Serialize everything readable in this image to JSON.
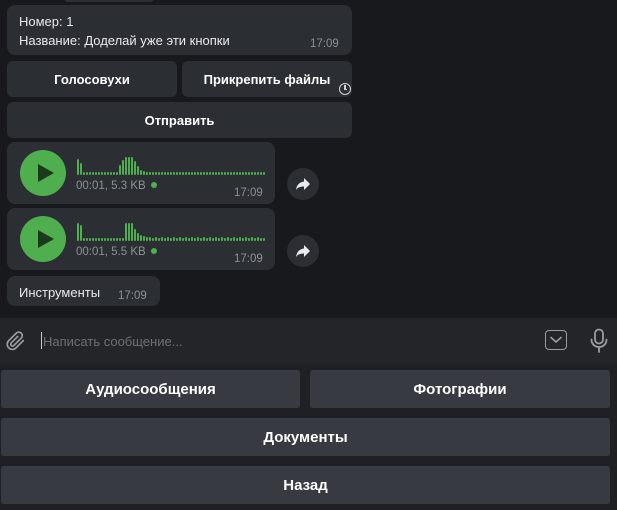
{
  "messages": {
    "info": {
      "number_line": "Номер: 1",
      "name_line": "Название: Доделай уже эти кнопки",
      "time": "17:09"
    },
    "inline_buttons": {
      "voices": "Голосовухи",
      "attach_files": "Прикрепить файлы",
      "send": "Отправить"
    },
    "voice_messages": [
      {
        "duration": "00:01",
        "size": "5.3 KB",
        "time": "17:09"
      },
      {
        "duration": "00:01",
        "size": "5.5 KB",
        "time": "17:09"
      }
    ],
    "tools": {
      "text": "Инструменты",
      "time": "17:09"
    }
  },
  "composer": {
    "placeholder": "Написать сообщение...",
    "value": ""
  },
  "keyboard": {
    "audio": "Аудиосообщения",
    "photos": "Фотографии",
    "documents": "Документы",
    "back": "Назад"
  },
  "icons": {
    "attach": "paperclip-icon",
    "keyboard_toggle": "chevron-down-icon",
    "mic": "microphone-icon",
    "share": "share-arrow-icon",
    "play": "play-icon",
    "pending": "clock-icon"
  },
  "colors": {
    "background": "#17191d",
    "bubble": "#2b2e33",
    "accent_green": "#4fae4e",
    "keyboard_button": "#373a40"
  }
}
